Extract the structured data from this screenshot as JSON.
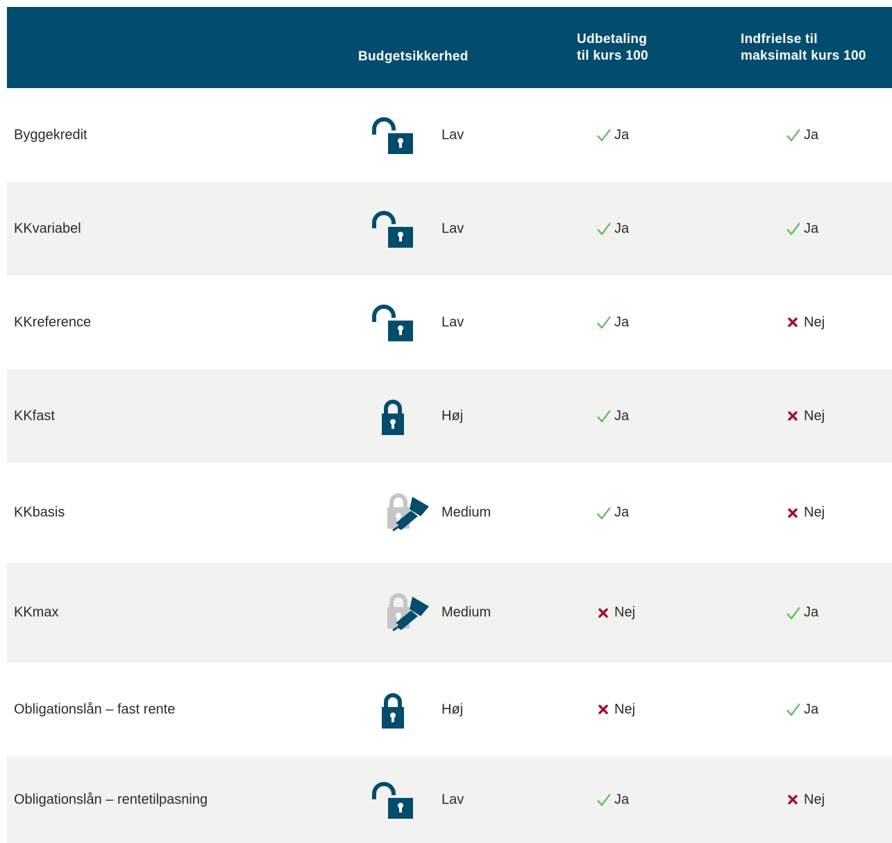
{
  "header": {
    "col_budget": "Budgetsikkerhed",
    "col_udbetaling_line1": "Udbetaling",
    "col_udbetaling_line2": "til kurs 100",
    "col_indfrielse_line1": "Indfrielse til",
    "col_indfrielse_line2": "maksimalt kurs 100",
    "background_color": "#024d6e"
  },
  "colors": {
    "icon": "#024d6e",
    "icon_grey": "#c6c6c6",
    "check": "#5cb85c",
    "cross": "#a0102a",
    "row_shade": "#f2f2f0"
  },
  "rows": [
    {
      "name": "Byggekredit",
      "icon": "lock-open-icon",
      "level": "Lav",
      "udbetaling": {
        "mark": "check-icon",
        "label": "Ja"
      },
      "indfrielse": {
        "mark": "check-icon",
        "label": "Ja"
      }
    },
    {
      "name": "KKvariabel",
      "icon": "lock-open-icon",
      "level": "Lav",
      "udbetaling": {
        "mark": "check-icon",
        "label": "Ja"
      },
      "indfrielse": {
        "mark": "check-icon",
        "label": "Ja"
      }
    },
    {
      "name": "KKreference",
      "icon": "lock-open-icon",
      "level": "Lav",
      "udbetaling": {
        "mark": "check-icon",
        "label": "Ja"
      },
      "indfrielse": {
        "mark": "cross-icon",
        "label": "Nej"
      }
    },
    {
      "name": "KKfast",
      "icon": "lock-closed-icon",
      "level": "Høj",
      "udbetaling": {
        "mark": "check-icon",
        "label": "Ja"
      },
      "indfrielse": {
        "mark": "cross-icon",
        "label": "Nej"
      }
    },
    {
      "name": "KKbasis",
      "icon": "lock-key-icon",
      "level": "Medium",
      "udbetaling": {
        "mark": "check-icon",
        "label": "Ja"
      },
      "indfrielse": {
        "mark": "cross-icon",
        "label": "Nej"
      }
    },
    {
      "name": "KKmax",
      "icon": "lock-key-icon",
      "level": "Medium",
      "udbetaling": {
        "mark": "cross-icon",
        "label": "Nej"
      },
      "indfrielse": {
        "mark": "check-icon",
        "label": "Ja"
      }
    },
    {
      "name": "Obligationslån – fast rente",
      "icon": "lock-closed-icon",
      "level": "Høj",
      "udbetaling": {
        "mark": "cross-icon",
        "label": "Nej"
      },
      "indfrielse": {
        "mark": "check-icon",
        "label": "Ja"
      }
    },
    {
      "name": "Obligationslån – rentetilpasning",
      "icon": "lock-open-icon",
      "level": "Lav",
      "udbetaling": {
        "mark": "check-icon",
        "label": "Ja"
      },
      "indfrielse": {
        "mark": "cross-icon",
        "label": "Nej"
      }
    }
  ]
}
